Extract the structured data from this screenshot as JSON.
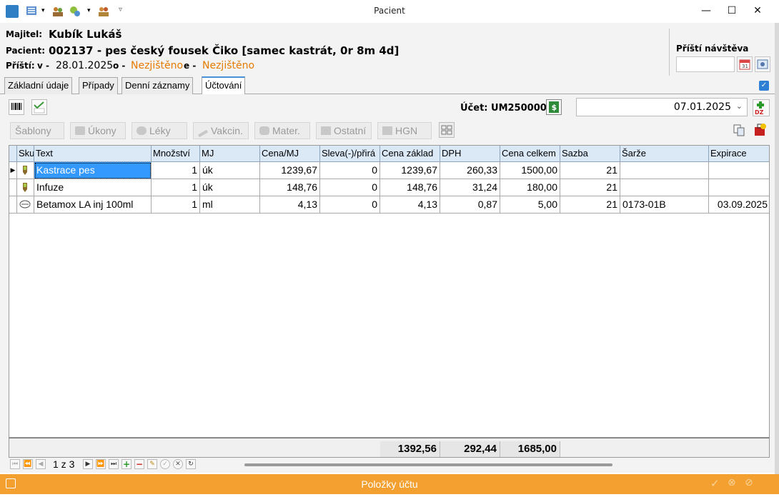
{
  "window": {
    "title": "Pacient"
  },
  "header": {
    "owner_label": "Majitel:",
    "owner_name": "Kubík Lukáš",
    "patient_label": "Pacient:",
    "patient_value": "002137 - pes český fousek Čiko [samec kastrát, 0r  8m  4d]",
    "next_label": "Příští:",
    "v_label": "v -",
    "v_value": "28.01.2025",
    "o_label": "o -",
    "o_value": "Nezjištěno",
    "e_label": "e -",
    "e_value": "Nezjištěno",
    "next_visit_label": "Příští návštěva",
    "next_visit_value": ""
  },
  "tabs": [
    {
      "label": "Základní údaje"
    },
    {
      "label": "Případy"
    },
    {
      "label": "Denní záznamy"
    },
    {
      "label": "Účtování"
    }
  ],
  "account": {
    "label": "Účet: UM2500002",
    "date": "07.01.2025"
  },
  "toolbar": [
    {
      "label": "Šablony"
    },
    {
      "label": "Úkony"
    },
    {
      "label": "Léky"
    },
    {
      "label": "Vakcin."
    },
    {
      "label": "Mater."
    },
    {
      "label": "Ostatní"
    },
    {
      "label": "HGN"
    }
  ],
  "grid": {
    "columns": [
      "Sku",
      "Text",
      "Množství",
      "MJ",
      "Cena/MJ",
      "Sleva(-)/přirá",
      "Cena základ",
      "DPH",
      "Cena celkem",
      "Sazba",
      "Šarže",
      "Expirace"
    ],
    "rows": [
      {
        "text": "Kastrace pes",
        "qty": "1",
        "mj": "úk",
        "price": "1239,67",
        "discount": "0",
        "base": "1239,67",
        "vat": "260,33",
        "total": "1500,00",
        "rate": "21",
        "batch": "",
        "expiry": ""
      },
      {
        "text": "Infuze",
        "qty": "1",
        "mj": "úk",
        "price": "148,76",
        "discount": "0",
        "base": "148,76",
        "vat": "31,24",
        "total": "180,00",
        "rate": "21",
        "batch": "",
        "expiry": ""
      },
      {
        "text": "Betamox LA inj 100ml",
        "qty": "1",
        "mj": "ml",
        "price": "4,13",
        "discount": "0",
        "base": "4,13",
        "vat": "0,87",
        "total": "5,00",
        "rate": "21",
        "batch": "0173-01B",
        "expiry": "03.09.2025"
      }
    ],
    "totals": {
      "base": "1392,56",
      "vat": "292,44",
      "total": "1685,00"
    }
  },
  "pager": {
    "text": "1 z 3"
  },
  "status": {
    "text": "Položky účtu"
  },
  "colors": {
    "status_bar": "#f3a030",
    "orange_text": "#e57b00",
    "selection": "#3399ff",
    "grid_header": "#dbe8f5"
  }
}
